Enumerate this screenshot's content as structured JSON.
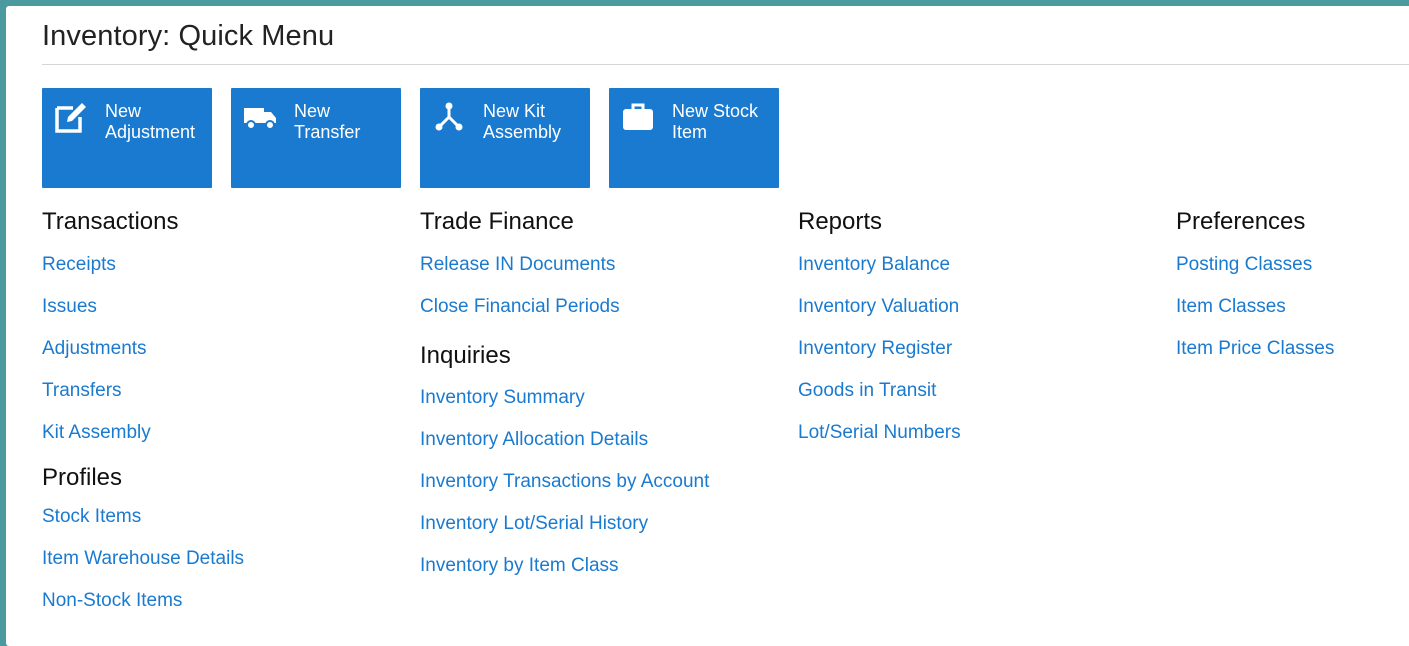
{
  "page": {
    "title": "Inventory: Quick Menu"
  },
  "tiles": [
    {
      "label": "New\nAdjustment",
      "icon": "edit-icon"
    },
    {
      "label": "New\nTransfer",
      "icon": "truck-icon"
    },
    {
      "label": "New Kit\nAssembly",
      "icon": "assembly-icon"
    },
    {
      "label": "New Stock\nItem",
      "icon": "briefcase-icon"
    }
  ],
  "columns": {
    "col1": {
      "transactions": {
        "heading": "Transactions",
        "links": [
          "Receipts",
          "Issues",
          "Adjustments",
          "Transfers",
          "Kit Assembly"
        ]
      },
      "profiles": {
        "heading": "Profiles",
        "links": [
          "Stock Items",
          "Item Warehouse Details",
          "Non-Stock Items"
        ]
      }
    },
    "col2": {
      "trade_finance": {
        "heading": "Trade Finance",
        "links": [
          "Release IN Documents",
          "Close Financial Periods"
        ]
      },
      "inquiries": {
        "heading": "Inquiries",
        "links": [
          "Inventory Summary",
          "Inventory Allocation Details",
          "Inventory Transactions by Account",
          "Inventory Lot/Serial History",
          "Inventory by Item Class"
        ]
      }
    },
    "col3": {
      "reports": {
        "heading": "Reports",
        "links": [
          "Inventory Balance",
          "Inventory Valuation",
          "Inventory Register",
          "Goods in Transit",
          "Lot/Serial Numbers"
        ]
      }
    },
    "col4": {
      "preferences": {
        "heading": "Preferences",
        "links": [
          "Posting Classes",
          "Item Classes",
          "Item Price Classes"
        ]
      }
    }
  },
  "colors": {
    "accent": "#1a7acf",
    "frame": "#4a9aa0",
    "heading": "#111111"
  }
}
